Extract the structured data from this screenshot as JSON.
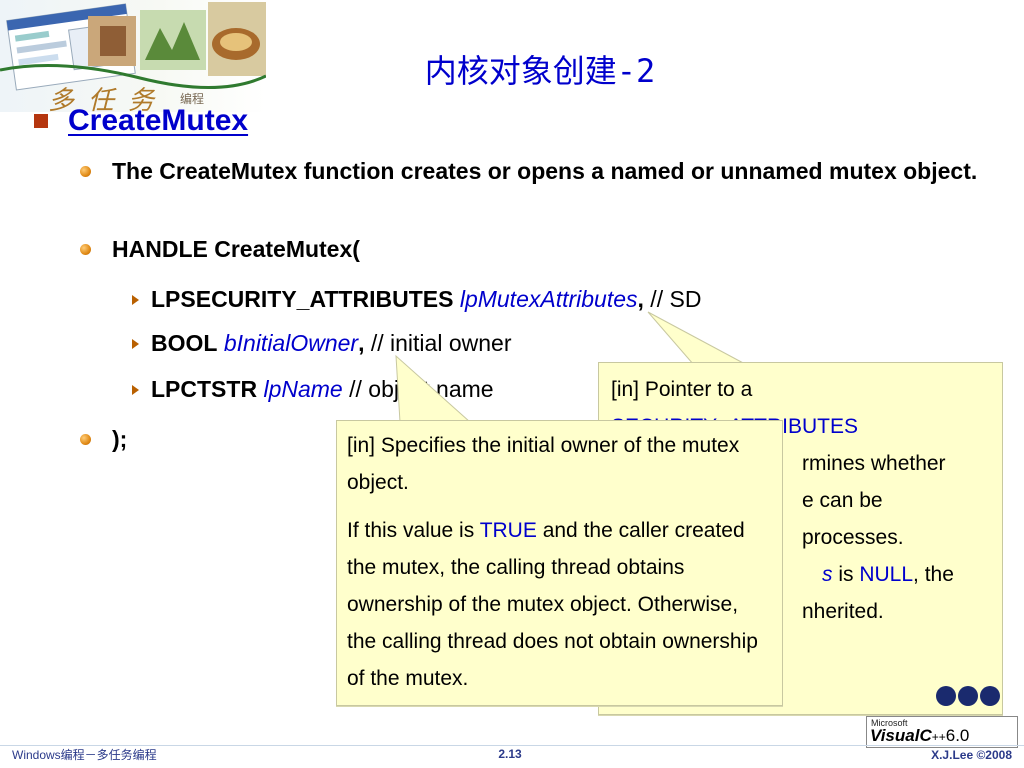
{
  "title": "内核对象创建-2",
  "logo": {
    "chars": "多任务",
    "sub": "编程"
  },
  "heading": "CreateMutex",
  "bullets": {
    "desc": "The CreateMutex function creates or opens a named or unnamed mutex object.",
    "sig_open": "HANDLE CreateMutex(",
    "sig_close": ");"
  },
  "params": [
    {
      "type": "LPSECURITY_ATTRIBUTES",
      "name": "lpMutexAttributes",
      "sep": ",",
      "comment": " // SD"
    },
    {
      "type": "BOOL",
      "name": "bInitialOwner",
      "sep": ",",
      "comment": " // initial owner"
    },
    {
      "type": "LPCTSTR",
      "name": "lpName",
      "sep": "",
      "comment": " // object name"
    }
  ],
  "callout_attrs": {
    "line1": "[in] Pointer to a",
    "line2": "SECURITY_ATTRIBUTES",
    "line3": "rmines whether",
    "line4": "e can be",
    "line5": "processes.",
    "line6_a": "s",
    "line6_b": " is ",
    "line6_c": "NULL",
    "line6_d": ", the",
    "line7": "nherited."
  },
  "callout_owner": {
    "para1": "[in] Specifies the initial owner of the mutex object.",
    "para2_a": "If this value is ",
    "para2_true": "TRUE",
    "para2_b": " and the caller created the mutex, the calling thread obtains ownership of the mutex object. Otherwise, the calling thread does not obtain ownership of the mutex."
  },
  "vc_logo": {
    "maker": "Microsoft",
    "name": "VisualC",
    "plus": "++",
    "version": "6.0"
  },
  "footer": {
    "left": "Windows编程－多任务编程",
    "page": "2.13",
    "right": "X.J.Lee ©2008"
  },
  "colors": {
    "title": "#0000cc",
    "square_bullet": "#b5360f",
    "dot_bullet": "#e08a16",
    "callout_bg": "#ffffcc",
    "footer_text": "#2b3a8a"
  }
}
